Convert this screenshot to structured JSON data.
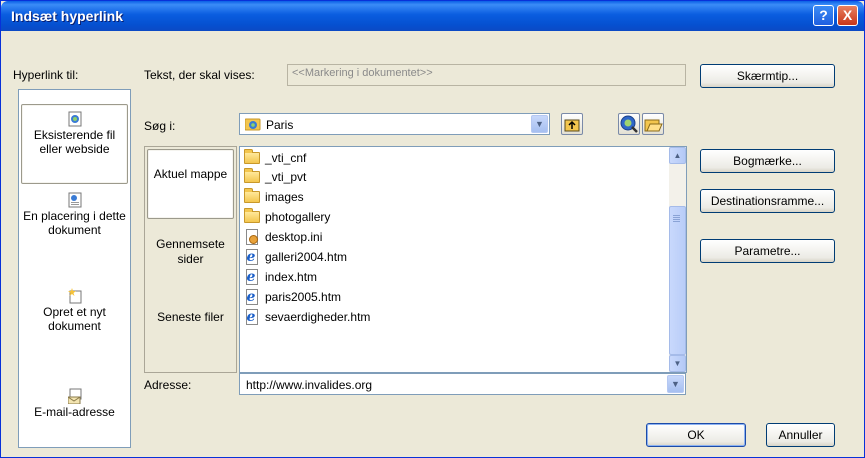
{
  "window": {
    "title": "Indsæt hyperlink",
    "help_glyph": "?",
    "close_glyph": "X"
  },
  "link_to": {
    "label": "Hyperlink til:",
    "items": [
      {
        "label": "Eksisterende fil eller webside",
        "icon": "existing-file-icon",
        "selected": true
      },
      {
        "label": "En placering i dette dokument",
        "icon": "place-in-document-icon",
        "selected": false
      },
      {
        "label": "Opret et nyt dokument",
        "icon": "new-document-icon",
        "selected": false
      },
      {
        "label": "E-mail-adresse",
        "icon": "email-icon",
        "selected": false
      }
    ]
  },
  "text_to_display": {
    "label": "Tekst, der skal vises:",
    "value": "<<Markering i dokumentet>>"
  },
  "screentip_button": "Skærmtip...",
  "look_in": {
    "label": "Søg i:",
    "value": "Paris"
  },
  "browse_tabs": [
    {
      "label": "Aktuel mappe",
      "selected": true
    },
    {
      "label": "Gennemsete sider",
      "selected": false
    },
    {
      "label": "Seneste filer",
      "selected": false
    }
  ],
  "files": [
    {
      "name": "_vti_cnf",
      "type": "folder"
    },
    {
      "name": "_vti_pvt",
      "type": "folder"
    },
    {
      "name": "images",
      "type": "folder"
    },
    {
      "name": "photogallery",
      "type": "folder"
    },
    {
      "name": "desktop.ini",
      "type": "ini"
    },
    {
      "name": "galleri2004.htm",
      "type": "htm"
    },
    {
      "name": "index.htm",
      "type": "htm"
    },
    {
      "name": "paris2005.htm",
      "type": "htm"
    },
    {
      "name": "sevaerdigheder.htm",
      "type": "htm"
    }
  ],
  "side_buttons": {
    "bookmark": "Bogmærke...",
    "target_frame": "Destinationsramme...",
    "parameters": "Parametre..."
  },
  "address": {
    "label": "Adresse:",
    "value": "http://www.invalides.org"
  },
  "ok_button": "OK",
  "cancel_button": "Annuller"
}
